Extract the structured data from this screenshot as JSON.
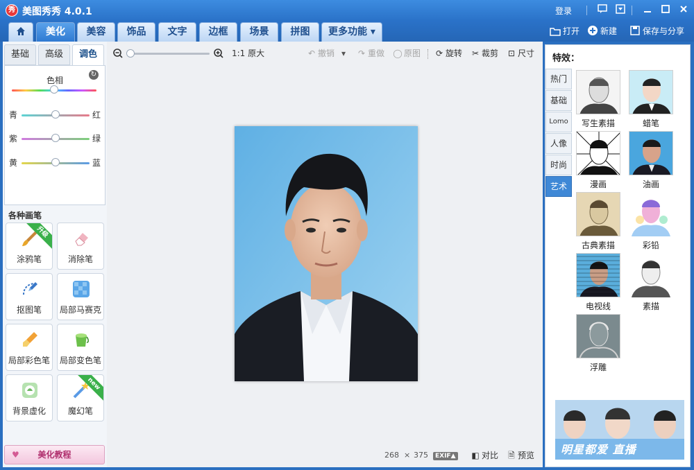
{
  "app": {
    "logo_text": "秀",
    "title": "美图秀秀 4.0.1",
    "login": "登录"
  },
  "window_icons": [
    "comment-icon",
    "dropdown-menu-icon",
    "minimize-icon",
    "maximize-icon",
    "close-icon"
  ],
  "tabs": [
    {
      "label": "",
      "icon": "home-icon"
    },
    {
      "label": "美化",
      "active": true
    },
    {
      "label": "美容"
    },
    {
      "label": "饰品"
    },
    {
      "label": "文字"
    },
    {
      "label": "边框"
    },
    {
      "label": "场景"
    },
    {
      "label": "拼图"
    },
    {
      "label": "更多功能 ▾"
    }
  ],
  "top_actions": {
    "open": "打开",
    "new": "新建",
    "save_share": "保存与分享"
  },
  "left": {
    "subtabs": [
      "基础",
      "高级",
      "调色"
    ],
    "hue_label": "色相",
    "sliders": [
      {
        "left": "青",
        "right": "红",
        "value": 0.5
      },
      {
        "left": "紫",
        "right": "绿",
        "value": 0.5
      },
      {
        "left": "黄",
        "right": "蓝",
        "value": 0.5
      }
    ],
    "hue_value": 0.5,
    "brush_section_title": "各种画笔",
    "brushes": [
      {
        "label": "涂鸦笔",
        "icon": "paintbrush-icon",
        "badge": "升级"
      },
      {
        "label": "消除笔",
        "icon": "eraser-icon"
      },
      {
        "label": "抠图笔",
        "icon": "cutout-pen-icon"
      },
      {
        "label": "局部马赛克",
        "icon": "mosaic-icon"
      },
      {
        "label": "局部彩色笔",
        "icon": "color-brush-icon"
      },
      {
        "label": "局部变色笔",
        "icon": "paint-bucket-icon"
      },
      {
        "label": "背景虚化",
        "icon": "blur-icon"
      },
      {
        "label": "魔幻笔",
        "icon": "magic-wand-icon",
        "badge": "new"
      }
    ],
    "tutorial": "美化教程"
  },
  "toolbar": {
    "zoom_value": 0.0,
    "original_size": "1:1 原大",
    "undo": "撤销",
    "redo": "重做",
    "original": "原图",
    "rotate": "旋转",
    "crop": "裁剪",
    "resize": "尺寸"
  },
  "status": {
    "width": "268",
    "x": "×",
    "height": "375",
    "exif": "EXIF▲",
    "compare": "对比",
    "preview": "预览"
  },
  "right": {
    "title": "特效：",
    "categories": [
      {
        "label": "热门"
      },
      {
        "label": "基础"
      },
      {
        "label": "Lomo"
      },
      {
        "label": "人像"
      },
      {
        "label": "时尚"
      },
      {
        "label": "艺术",
        "active": true
      }
    ],
    "effects": [
      "写生素描",
      "蜡笔",
      "漫画",
      "油画",
      "古典素描",
      "彩铅",
      "电视线",
      "素描",
      "浮雕"
    ],
    "ad_text": "明星都爱 直播"
  },
  "colors": {
    "accent": "#2f7ad2",
    "active_cat": "#3f88d6",
    "photo_bg": "#7cc0ea",
    "suit": "#1a1d24"
  }
}
